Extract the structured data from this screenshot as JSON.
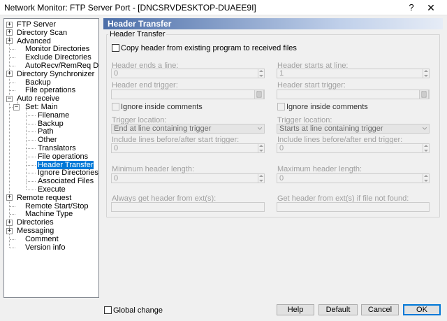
{
  "window": {
    "title": "Network Monitor: FTP Server Port - [DNCSRVDESKTOP-DUAEE9I]",
    "help_glyph": "?",
    "close_glyph": "✕"
  },
  "tree": {
    "items": [
      {
        "label": "FTP Server",
        "expander": "+"
      },
      {
        "label": "Directory Scan",
        "expander": "+"
      },
      {
        "label": "Advanced",
        "expander": "+"
      },
      {
        "label": "Monitor Directories"
      },
      {
        "label": "Exclude Directories"
      },
      {
        "label": "AutoRecv/RemReq Dirs."
      },
      {
        "label": "Directory Synchronizer",
        "expander": "+"
      },
      {
        "label": "Backup"
      },
      {
        "label": "File operations"
      },
      {
        "label": "Auto receive",
        "expander": "−"
      },
      {
        "label": "Set: Main",
        "expander": "−"
      },
      {
        "label": "Filename"
      },
      {
        "label": "Backup"
      },
      {
        "label": "Path"
      },
      {
        "label": "Other"
      },
      {
        "label": "Translators"
      },
      {
        "label": "File operations"
      },
      {
        "label": "Header Transfer"
      },
      {
        "label": "Ignore Directories"
      },
      {
        "label": "Associated Files"
      },
      {
        "label": "Execute"
      },
      {
        "label": "Remote request",
        "expander": "+"
      },
      {
        "label": "Remote Start/Stop"
      },
      {
        "label": "Machine Type"
      },
      {
        "label": "Directories",
        "expander": "+"
      },
      {
        "label": "Messaging",
        "expander": "+"
      },
      {
        "label": "Comment"
      },
      {
        "label": "Version info"
      }
    ]
  },
  "panel": {
    "title": "Header Transfer",
    "group_title": "Header Transfer",
    "copy_header_label": "Copy header from existing program to received files",
    "header_ends_label": "Header ends a line:",
    "header_ends_value": "0",
    "header_starts_label": "Header starts at line:",
    "header_starts_value": "1",
    "header_end_trigger_label": "Header end trigger:",
    "header_start_trigger_label": "Header start trigger:",
    "ignore_comments_left": "Ignore inside comments",
    "ignore_comments_right": "Ignore inside comments",
    "trigger_location_left_label": "Trigger location:",
    "trigger_location_left_value": "End at line containing trigger",
    "trigger_location_right_label": "Trigger location:",
    "trigger_location_right_value": "Starts at line containing trigger",
    "include_before_after_start_label": "Include lines before/after start trigger:",
    "include_before_after_start_value": "0",
    "include_before_after_end_label": "Include lines before/after end trigger:",
    "include_before_after_end_value": "0",
    "min_header_label": "Minimum header length:",
    "min_header_value": "0",
    "max_header_label": "Maximum header length:",
    "max_header_value": "0",
    "always_get_label": "Always get header from ext(s):",
    "always_get_value": "",
    "get_if_not_found_label": "Get header from ext(s) if file not found:",
    "get_if_not_found_value": ""
  },
  "bottom": {
    "global_change_label": "Global change",
    "help_label": "Help",
    "default_label": "Default",
    "cancel_label": "Cancel",
    "ok_label": "OK"
  },
  "colors": {
    "header_gradient_start": "#4c6ea8",
    "selection": "#0078d7",
    "disabled_text": "#a0a0a0"
  }
}
